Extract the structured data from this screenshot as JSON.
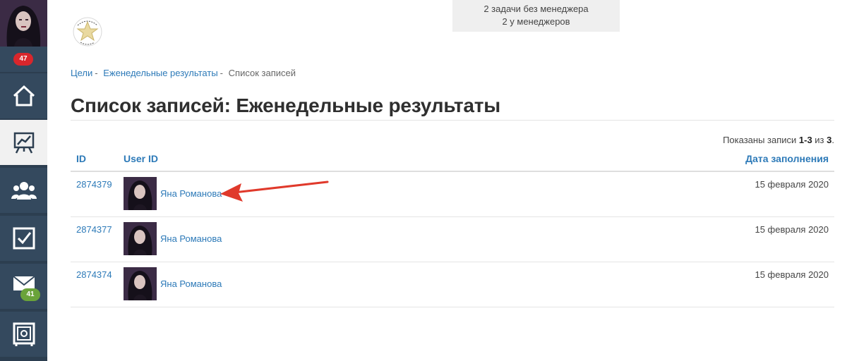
{
  "sidebar": {
    "notifications_badge": "47",
    "messages_badge": "41",
    "items": [
      {
        "name": "home",
        "icon": "home-icon"
      },
      {
        "name": "goals",
        "icon": "chart-board-icon",
        "active": true
      },
      {
        "name": "team",
        "icon": "users-icon"
      },
      {
        "name": "tasks",
        "icon": "checkbox-icon"
      },
      {
        "name": "messages",
        "icon": "envelope-icon"
      },
      {
        "name": "safe",
        "icon": "safe-icon"
      }
    ]
  },
  "info_box": {
    "line1": "2 задачи без менеджера",
    "line2": "2 у менеджеров"
  },
  "breadcrumb": {
    "item1": "Цели",
    "item2": "Еженедельные результаты",
    "current": "Список записей",
    "separator": "-"
  },
  "page": {
    "title": "Список записей: Еженедельные результаты"
  },
  "records_count": {
    "prefix": "Показаны записи ",
    "range": "1-3",
    "middle": " из ",
    "total": "3",
    "suffix": "."
  },
  "table": {
    "headers": {
      "id": "ID",
      "user": "User ID",
      "date": "Дата заполнения"
    },
    "rows": [
      {
        "id": "2874379",
        "user": "Яна Романова",
        "date": "15 февраля 2020"
      },
      {
        "id": "2874377",
        "user": "Яна Романова",
        "date": "15 февраля 2020"
      },
      {
        "id": "2874374",
        "user": "Яна Романова",
        "date": "15 февраля 2020"
      }
    ]
  },
  "colors": {
    "sidebar": "#2c3e50",
    "link": "#2d7ab8",
    "badge_red": "#d9262c",
    "badge_green": "#6aa33a",
    "annotation_arrow": "#e0392b"
  }
}
